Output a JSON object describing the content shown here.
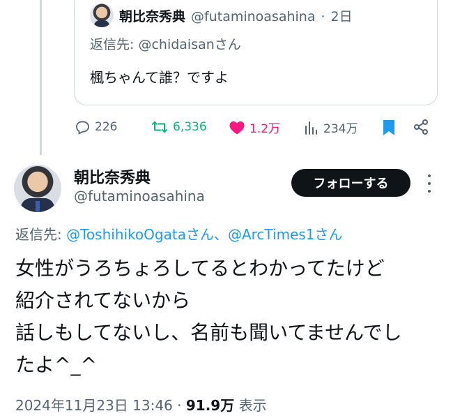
{
  "quoted_tweet": {
    "name": "朝比奈秀典",
    "handle": "@futaminoasahina",
    "dot": "·",
    "time": "2日",
    "reply_prefix": "返信先: ",
    "reply_target": "@chidaisanさん",
    "body": "楓ちゃんて誰？ですよ"
  },
  "actions": {
    "replies": "226",
    "retweets": "6,336",
    "likes": "1.2万",
    "views": "234万"
  },
  "tweet": {
    "name": "朝比奈秀典",
    "handle": "@futaminoasahina",
    "follow_label": "フォローする",
    "reply_prefix": "返信先: ",
    "reply_targets": "@ToshihikoOgataさん、@ArcTimes1さん",
    "lines": [
      "女性がうろちょろしてるとわかってたけど",
      "紹介されてないから",
      "話しもしてないし、名前も聞いてませんでし",
      "たよ^_^"
    ],
    "datetime": "2024年11月23日 13:46",
    "dot": " · ",
    "views": "91.9万",
    "views_label": " 表示"
  },
  "colors": {
    "accent": "#1d9bf0",
    "retweet": "#00ba7c",
    "like": "#f91880",
    "secondary_text": "#536471"
  },
  "icons": [
    "reply-icon",
    "retweet-icon",
    "heart-icon",
    "views-icon",
    "bookmark-icon",
    "share-icon",
    "more-icon"
  ]
}
